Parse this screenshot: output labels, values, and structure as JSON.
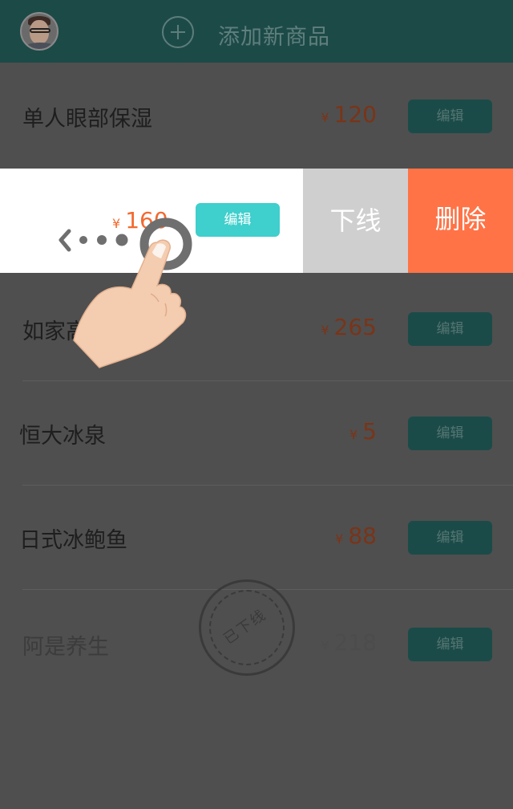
{
  "header": {
    "title": "添加新商品"
  },
  "items": [
    {
      "name": "单人眼部保湿",
      "currency": "¥",
      "price": "120",
      "edit_label": "编辑"
    },
    {
      "name": "",
      "currency": "¥",
      "price": "160",
      "edit_label": "编辑",
      "actions": {
        "offline": "下线",
        "delete": "删除"
      }
    },
    {
      "name": "如家高",
      "name_tail": "房",
      "currency": "¥",
      "price": "265",
      "edit_label": "编辑"
    },
    {
      "name": "恒大冰泉",
      "currency": "¥",
      "price": "5",
      "edit_label": "编辑"
    },
    {
      "name": "日式冰鲍鱼",
      "currency": "¥",
      "price": "88",
      "edit_label": "编辑"
    },
    {
      "name": "阿是养生",
      "currency": "¥",
      "price": "218",
      "edit_label": "编辑",
      "stamp": "已下线"
    }
  ],
  "colors": {
    "header_bg": "#1c4a47",
    "accent": "#3fcfcc",
    "price": "#f26a2f",
    "delete": "#ff7346",
    "offline": "#cfcfcf"
  },
  "icons": {
    "add": "plus-circle-icon",
    "gesture": "swipe-left-hand-icon"
  }
}
